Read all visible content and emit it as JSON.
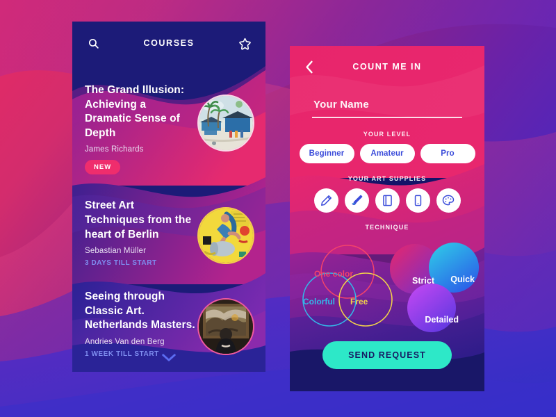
{
  "background": {
    "gradient_from": "#e62a64",
    "gradient_mid": "#8e2388",
    "gradient_to": "#2b2fc4"
  },
  "courses_screen": {
    "header": {
      "title": "COURSES",
      "search_icon": "search-icon",
      "favorite_icon": "star-icon"
    },
    "scroll_hint_icon": "chevron-down-icon",
    "panel_color": "#1c1b78",
    "items": [
      {
        "title": "The Grand Illusion: Achieving a Dramatic Sense of Depth",
        "author": "James Richards",
        "badge": "NEW",
        "meta": "",
        "thumb_alt": "tropical-village-watercolor"
      },
      {
        "title": "Street Art Techniques from the heart of Berlin",
        "author": "Sebastian Müller",
        "badge": "",
        "meta": "3 DAYS TILL START",
        "thumb_alt": "street-art-mural"
      },
      {
        "title": "Seeing through Classic Art. Netherlands Masters.",
        "author": "Andries Van den Berg",
        "badge": "",
        "meta": "1 WEEK TILL START",
        "thumb_alt": "museum-visitor-painting"
      }
    ]
  },
  "signup_screen": {
    "header": {
      "title": "COUNT ME IN",
      "back_icon": "chevron-left-icon"
    },
    "name_field": {
      "value": "",
      "placeholder": "Your Name"
    },
    "level": {
      "label": "YOUR LEVEL",
      "options": [
        "Beginner",
        "Amateur",
        "Pro"
      ],
      "text_color": "#3b4cda"
    },
    "supplies": {
      "label": "YOUR ART SUPPLIES",
      "items": [
        {
          "icon": "pencil-icon"
        },
        {
          "icon": "paintbrush-icon"
        },
        {
          "icon": "sketchbook-icon"
        },
        {
          "icon": "tablet-icon"
        },
        {
          "icon": "palette-icon"
        }
      ]
    },
    "technique": {
      "label": "TECHNIQUE",
      "venn": [
        {
          "text": "One color",
          "color": "#f2426b"
        },
        {
          "text": "Colorful",
          "color": "#34b6e8"
        },
        {
          "text": "Free",
          "color": "#f2d14a"
        }
      ],
      "blobs": [
        {
          "text": "Strict",
          "from": "#e8276b",
          "to": "#6f2fd0"
        },
        {
          "text": "Quick",
          "from": "#2fb7e8",
          "to": "#2b6ce8"
        },
        {
          "text": "Detailed",
          "from": "#b944f2",
          "to": "#5a37e0"
        }
      ]
    },
    "submit": {
      "label": "SEND REQUEST",
      "bg": "#2de8c8",
      "text_color": "#171a63"
    }
  }
}
